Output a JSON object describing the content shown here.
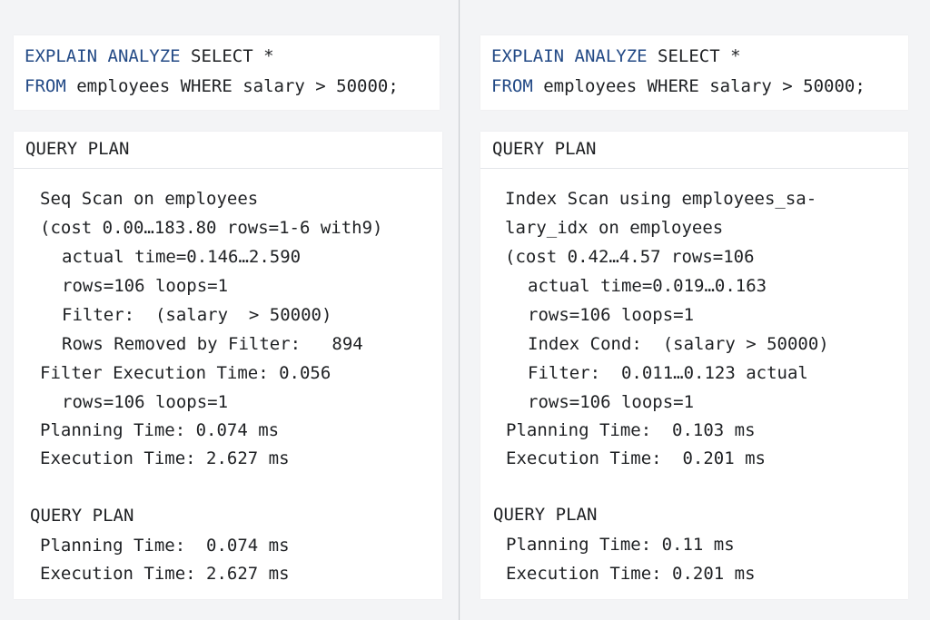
{
  "left": {
    "sql": {
      "line1_kw": "EXPLAIN ANALYZE",
      "line1_rest": " SELECT *",
      "line2_kw": "FROM",
      "line2_rest": " employees WHERE salary > 50000;"
    },
    "plan_title": "QUERY PLAN",
    "plan_lines": [
      "Seq Scan on employees",
      "(cost 0.00…183.80 rows=1-6 with9)",
      "actual time=0.146…2.590",
      "rows=106 loops=1",
      "Filter:  (salary  > 50000)",
      "Rows Removed by Filter:   894",
      "Filter Execution Time: 0.056",
      "rows=106 loops=1",
      "Planning Time: 0.074 ms",
      "Execution Time: 2.627 ms"
    ],
    "summary_title": "QUERY PLAN",
    "summary_lines": [
      "Planning Time:  0.074 ms",
      "Execution Time: 2.627 ms"
    ]
  },
  "right": {
    "sql": {
      "line1_kw": "EXPLAIN ANALYZE",
      "line1_rest": " SELECT *",
      "line2_kw": "FROM",
      "line2_rest": " employees WHERE salary > 50000;"
    },
    "plan_title": "QUERY PLAN",
    "plan_lines": [
      "Index Scan using employees_sa-",
      "lary_idx on employees",
      "(cost 0.42…4.57 rows=106",
      "actual time=0.019…0.163",
      "rows=106 loops=1",
      "Index Cond:  (salary > 50000)",
      "Filter:  0.011…0.123 actual",
      "rows=106 loops=1",
      "Planning Time:  0.103 ms",
      "Execution Time:  0.201 ms"
    ],
    "summary_title": "QUERY PLAN",
    "summary_lines": [
      "Planning Time: 0.11 ms",
      "Execution Time: 0.201 ms"
    ]
  },
  "colors": {
    "keyword": "#234a86",
    "text": "#1e2023",
    "card": "#ffffff",
    "background": "#f3f4f6"
  }
}
